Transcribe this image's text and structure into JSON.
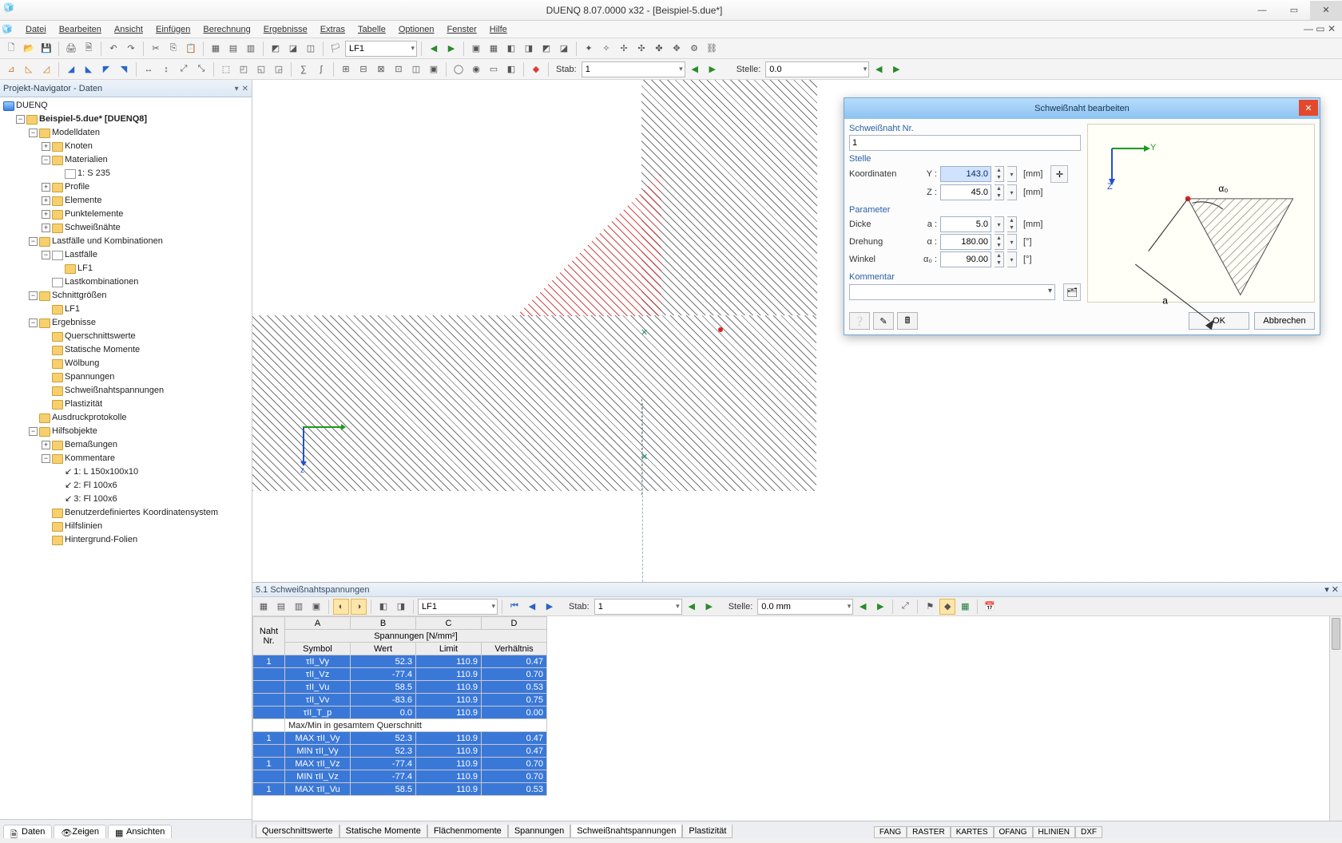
{
  "app": {
    "title": "DUENQ 8.07.0000 x32 - [Beispiel-5.due*]"
  },
  "menu": [
    "Datei",
    "Bearbeiten",
    "Ansicht",
    "Einfügen",
    "Berechnung",
    "Ergebnisse",
    "Extras",
    "Tabelle",
    "Optionen",
    "Fenster",
    "Hilfe"
  ],
  "tb2": {
    "lf_combo": "LF1"
  },
  "tb3": {
    "stab_label": "Stab:",
    "stab_value": "1",
    "stelle_label": "Stelle:",
    "stelle_value": "0.0"
  },
  "navigator": {
    "title": "Projekt-Navigator - Daten",
    "root": "DUENQ",
    "project": "Beispiel-5.due* [DUENQ8]",
    "groups": {
      "model": "Modelldaten",
      "model_children": [
        "Knoten",
        "Materialien",
        "Profile",
        "Elemente",
        "Punktelemente",
        "Schweißnähte"
      ],
      "material_child": "1: S 235",
      "loads": "Lastfälle und Kombinationen",
      "lastfaelle": "Lastfälle",
      "lf1": "LF1",
      "lastkomb": "Lastkombinationen",
      "schnitt": "Schnittgrößen",
      "schnitt_lf1": "LF1",
      "ergebnisse": "Ergebnisse",
      "erg_children": [
        "Querschnittswerte",
        "Statische Momente",
        "Wölbung",
        "Spannungen",
        "Schweißnahtspannungen",
        "Plastizität"
      ],
      "ausdruck": "Ausdruckprotokolle",
      "hilfs": "Hilfsobjekte",
      "bemass": "Bemaßungen",
      "kommentare": "Kommentare",
      "komm_children": [
        "1: L 150x100x10",
        "2: Fl 100x6",
        "3: Fl 100x6"
      ],
      "koord": "Benutzerdefiniertes Koordinatensystem",
      "hilfslin": "Hilfslinien",
      "hintergrund": "Hintergrund-Folien"
    },
    "tabs": [
      "Daten",
      "Zeigen",
      "Ansichten"
    ]
  },
  "bottom": {
    "title": "5.1 Schweißnahtspannungen",
    "lf_combo": "LF1",
    "stab_label": "Stab:",
    "stab_value": "1",
    "stelle_label": "Stelle:",
    "stelle_value": "0.0 mm",
    "cols_letters": [
      "A",
      "B",
      "C",
      "D"
    ],
    "header_group": "Spannungen [N/mm²]",
    "header_naht": "Naht\nNr.",
    "headers": [
      "Symbol",
      "Wert",
      "Limit",
      "Verhältnis"
    ],
    "rows": [
      {
        "naht": "1",
        "sym": "τII_Vy",
        "w": "52.3",
        "l": "110.9",
        "v": "0.47",
        "blue": true
      },
      {
        "naht": "",
        "sym": "τII_Vz",
        "w": "-77.4",
        "l": "110.9",
        "v": "0.70",
        "blue": true
      },
      {
        "naht": "",
        "sym": "τII_Vu",
        "w": "58.5",
        "l": "110.9",
        "v": "0.53",
        "blue": true
      },
      {
        "naht": "",
        "sym": "τII_Vv",
        "w": "-83.6",
        "l": "110.9",
        "v": "0.75",
        "blue": true
      },
      {
        "naht": "",
        "sym": "τII_T_p",
        "w": "0.0",
        "l": "110.9",
        "v": "0.00",
        "blue": true
      }
    ],
    "subhead": "Max/Min in gesamtem Querschnitt",
    "rows2": [
      {
        "naht": "1",
        "sym": "MAX τII_Vy",
        "w": "52.3",
        "l": "110.9",
        "v": "0.47",
        "blue": true
      },
      {
        "naht": "",
        "sym": "MIN τII_Vy",
        "w": "52.3",
        "l": "110.9",
        "v": "0.47",
        "blue": true
      },
      {
        "naht": "1",
        "sym": "MAX τII_Vz",
        "w": "-77.4",
        "l": "110.9",
        "v": "0.70",
        "blue": true
      },
      {
        "naht": "",
        "sym": "MIN τII_Vz",
        "w": "-77.4",
        "l": "110.9",
        "v": "0.70",
        "blue": true
      },
      {
        "naht": "1",
        "sym": "MAX τII_Vu",
        "w": "58.5",
        "l": "110.9",
        "v": "0.53",
        "blue": true
      }
    ],
    "tabs": [
      "Querschnittswerte",
      "Statische Momente",
      "Flächenmomente",
      "Spannungen",
      "Schweißnahtspannungen",
      "Plastizität"
    ],
    "active_tab": 4
  },
  "dialog": {
    "title": "Schweißnaht bearbeiten",
    "nr_label": "Schweißnaht Nr.",
    "nr_value": "1",
    "stelle_label": "Stelle",
    "koord_label": "Koordinaten",
    "y_label": "Y :",
    "y_value": "143.0",
    "y_unit": "[mm]",
    "z_label": "Z :",
    "z_value": "45.0",
    "z_unit": "[mm]",
    "param_label": "Parameter",
    "dicke_label": "Dicke",
    "a_sym": "a :",
    "a_value": "5.0",
    "a_unit": "[mm]",
    "dreh_label": "Drehung",
    "alpha_sym": "α :",
    "alpha_value": "180.00",
    "alpha_unit": "[°]",
    "winkel_label": "Winkel",
    "a0_sym": "α₀ :",
    "a0_value": "90.00",
    "a0_unit": "[°]",
    "komm_label": "Kommentar",
    "komm_value": "",
    "ok": "OK",
    "cancel": "Abbrechen",
    "fig_y": "Y",
    "fig_z": "Z",
    "fig_a0": "α₀",
    "fig_a": "a"
  },
  "status": [
    "FANG",
    "RASTER",
    "KARTES",
    "OFANG",
    "HLINIEN",
    "DXF"
  ]
}
